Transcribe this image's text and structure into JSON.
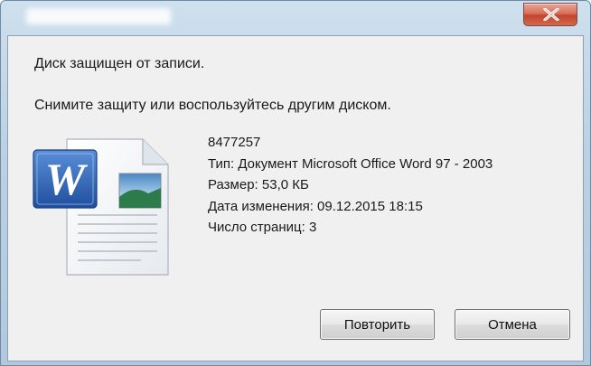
{
  "dialog": {
    "message_primary": "Диск защищен от записи.",
    "message_secondary": "Снимите защиту или воспользуйтесь другим диском."
  },
  "file": {
    "name": "8477257",
    "type_line": "Тип: Документ Microsoft Office Word 97 - 2003",
    "size_line": "Размер: 53,0 КБ",
    "modified_line": "Дата изменения: 09.12.2015 18:15",
    "pages_line": "Число страниц: 3",
    "icon": "word-document-icon",
    "icon_letter": "W"
  },
  "buttons": {
    "retry_label": "Повторить",
    "cancel_label": "Отмена"
  },
  "colors": {
    "client_background": "#f0f0f0",
    "word_blue": "#2e62b8",
    "close_red": "#c2452c"
  }
}
